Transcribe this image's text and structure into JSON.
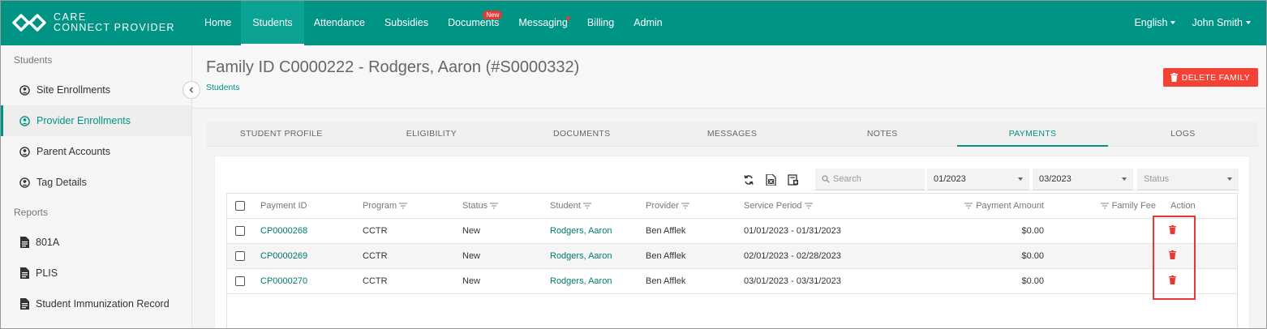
{
  "app": {
    "logo_line1": "CARE",
    "logo_line2": "CONNECT PROVIDER"
  },
  "nav": {
    "items": [
      {
        "label": "Home"
      },
      {
        "label": "Students",
        "active": true
      },
      {
        "label": "Attendance"
      },
      {
        "label": "Subsidies"
      },
      {
        "label": "Documents",
        "badge": "New"
      },
      {
        "label": "Messaging",
        "dot": true
      },
      {
        "label": "Billing"
      },
      {
        "label": "Admin"
      }
    ],
    "language": "English",
    "user": "John Smith"
  },
  "sidebar": {
    "section_students": "Students",
    "students_items": [
      {
        "label": "Site Enrollments",
        "icon": "person-circle-icon"
      },
      {
        "label": "Provider Enrollments",
        "icon": "person-circle-icon",
        "active": true
      },
      {
        "label": "Parent Accounts",
        "icon": "person-circle-icon"
      },
      {
        "label": "Tag Details",
        "icon": "person-circle-icon"
      }
    ],
    "section_reports": "Reports",
    "reports_items": [
      {
        "label": "801A",
        "icon": "document-icon"
      },
      {
        "label": "PLIS",
        "icon": "document-icon"
      },
      {
        "label": "Student Immunization Record",
        "icon": "document-icon"
      }
    ]
  },
  "header": {
    "title": "Family ID C0000222 - Rodgers, Aaron (#S0000332)",
    "breadcrumb": "Students",
    "delete_button": "DELETE FAMILY"
  },
  "tabs": [
    {
      "label": "STUDENT PROFILE"
    },
    {
      "label": "ELIGIBILITY"
    },
    {
      "label": "DOCUMENTS"
    },
    {
      "label": "MESSAGES"
    },
    {
      "label": "NOTES"
    },
    {
      "label": "PAYMENTS",
      "active": true
    },
    {
      "label": "LOGS"
    }
  ],
  "filters": {
    "search_placeholder": "Search",
    "from_month": "01/2023",
    "to_month": "03/2023",
    "status_placeholder": "Status"
  },
  "table": {
    "headers": {
      "payment_id": "Payment ID",
      "program": "Program",
      "status": "Status",
      "student": "Student",
      "provider": "Provider",
      "service_period": "Service Period",
      "payment_amount": "Payment Amount",
      "family_fee": "Family Fee",
      "action": "Action"
    },
    "rows": [
      {
        "payment_id": "CP0000268",
        "program": "CCTR",
        "status": "New",
        "student": "Rodgers, Aaron",
        "provider": "Ben Afflek",
        "service_period": "01/01/2023 - 01/31/2023",
        "payment_amount": "$0.00"
      },
      {
        "payment_id": "CP0000269",
        "program": "CCTR",
        "status": "New",
        "student": "Rodgers, Aaron",
        "provider": "Ben Afflek",
        "service_period": "02/01/2023 - 02/28/2023",
        "payment_amount": "$0.00"
      },
      {
        "payment_id": "CP0000270",
        "program": "CCTR",
        "status": "New",
        "student": "Rodgers, Aaron",
        "provider": "Ben Afflek",
        "service_period": "03/01/2023 - 03/31/2023",
        "payment_amount": "$0.00"
      }
    ]
  },
  "colors": {
    "brand": "#009485",
    "danger": "#f44336",
    "highlight": "#e53935"
  }
}
